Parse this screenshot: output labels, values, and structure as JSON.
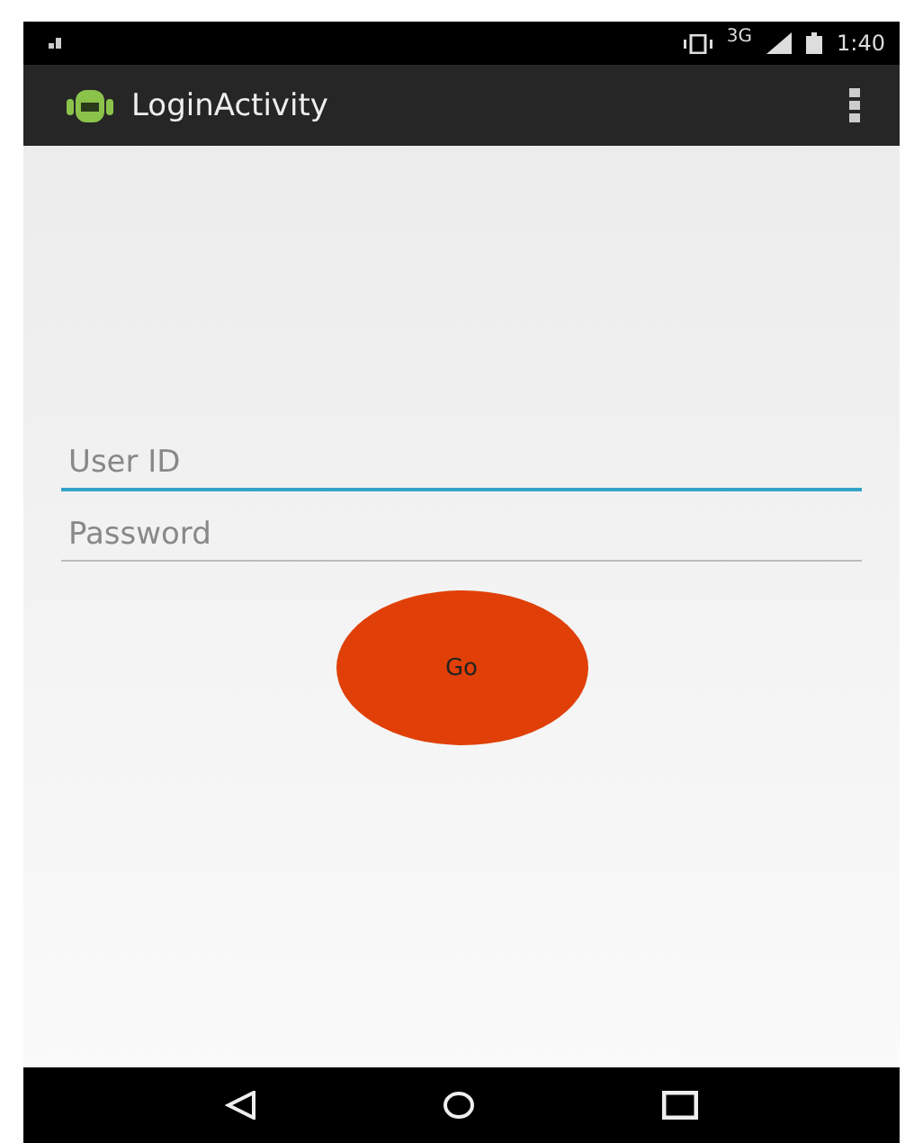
{
  "status_bar": {
    "network": "3G",
    "time": "1:40"
  },
  "action_bar": {
    "title": "LoginActivity"
  },
  "fields": [
    {
      "placeholder": "User ID",
      "focused": true
    },
    {
      "placeholder": "Password",
      "focused": false
    }
  ],
  "button": {
    "label": "Go"
  }
}
